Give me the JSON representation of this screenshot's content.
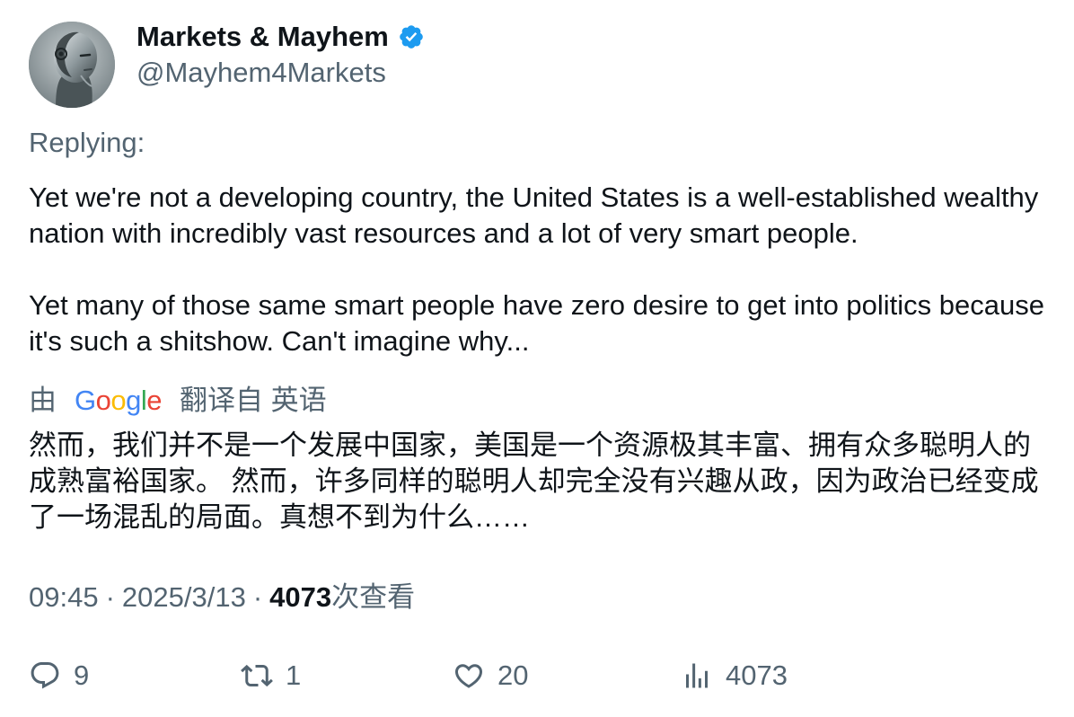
{
  "author": {
    "display_name": "Markets & Mayhem",
    "handle": "@Mayhem4Markets",
    "verified_color": "#1d9bf0"
  },
  "replying_label": "Replying:",
  "tweet": {
    "paragraphs": [
      "Yet we're not a developing country, the United States is a well-established wealthy nation with incredibly vast resources and a lot of very smart people.",
      "Yet many of those same smart people have zero desire to get into politics because it's such a shitshow. Can't imagine why..."
    ]
  },
  "translation": {
    "prefix": "由",
    "provider": "Google",
    "suffix": "翻译自 英语",
    "text": "然而，我们并不是一个发展中国家，美国是一个资源极其丰富、拥有众多聪明人的成熟富裕国家。 然而，许多同样的聪明人却完全没有兴趣从政，因为政治已经变成了一场混乱的局面。真想不到为什么……"
  },
  "meta": {
    "time": "09:45",
    "separator": "·",
    "date": "2025/3/13",
    "views": "4073",
    "views_label": "次查看"
  },
  "actions": {
    "reply": {
      "icon": "reply-icon",
      "count": "9"
    },
    "repost": {
      "icon": "repost-icon",
      "count": "1"
    },
    "like": {
      "icon": "heart-icon",
      "count": "20"
    },
    "views": {
      "icon": "views-icon",
      "count": "4073"
    }
  },
  "colors": {
    "text_primary": "#0f1419",
    "text_secondary": "#536471",
    "verified": "#1d9bf0"
  }
}
